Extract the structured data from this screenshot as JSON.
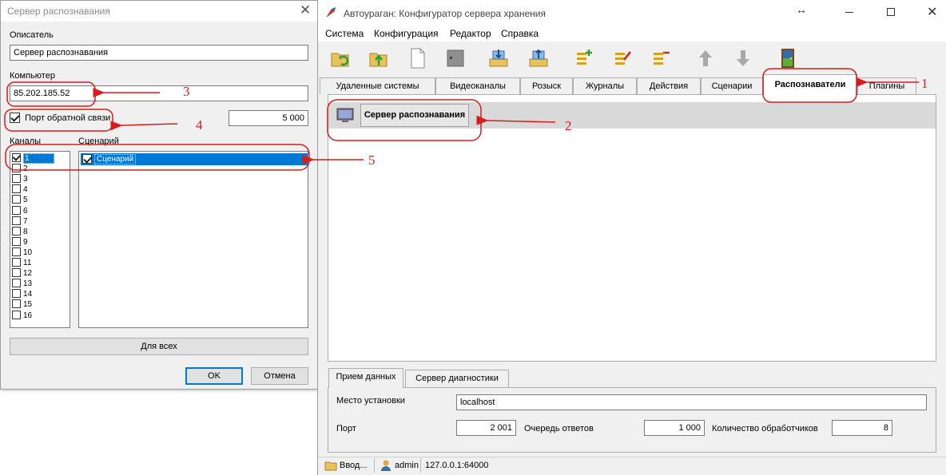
{
  "dialog": {
    "title": "Сервер распознавания",
    "descriptor_label": "Описатель",
    "descriptor_value": "Сервер распознавания",
    "computer_label": "Компьютер",
    "computer_value": "85.202.185.52",
    "callback_port_label": "Порт обратной связи",
    "callback_port_checked": true,
    "callback_port_value": "5 000",
    "channels_label": "Каналы",
    "scenario_label": "Сценарий",
    "channels": [
      "1",
      "2",
      "3",
      "4",
      "5",
      "6",
      "7",
      "8",
      "9",
      "10",
      "11",
      "12",
      "13",
      "14",
      "15",
      "16"
    ],
    "selected_channel": "1",
    "scenarios": [
      "Сценарий"
    ],
    "for_all_button": "Для всех",
    "ok_button": "OK",
    "cancel_button": "Отмена"
  },
  "main": {
    "title": "Автоураган: Конфигуратор сервера хранения",
    "menu": [
      "Система",
      "Конфигурация",
      "Редактор",
      "Справка"
    ],
    "tabs": [
      "Удаленные системы",
      "Видеоканалы",
      "Розыск",
      "Журналы",
      "Действия",
      "Сценарии",
      "Распознаватели",
      "Плагины"
    ],
    "active_tab": "Распознаватели",
    "recognizer_item": "Сервер распознавания",
    "bottom_tabs": [
      "Прием данных",
      "Сервер диагностики"
    ],
    "location_label": "Место установки",
    "location_value": "localhost",
    "port_label": "Порт",
    "port_value": "2 001",
    "queue_label": "Очередь ответов",
    "queue_value": "1 000",
    "handlers_label": "Количество обработчиков",
    "handlers_value": "8",
    "status": {
      "input": "Ввод...",
      "user": "admin",
      "address": "127.0.0.1:64000"
    }
  },
  "annotations": [
    "1",
    "2",
    "3",
    "4",
    "5"
  ],
  "colors": {
    "annotation": "#d81b1b",
    "selection": "#0078d7",
    "window_bg": "#f0f0f0"
  }
}
